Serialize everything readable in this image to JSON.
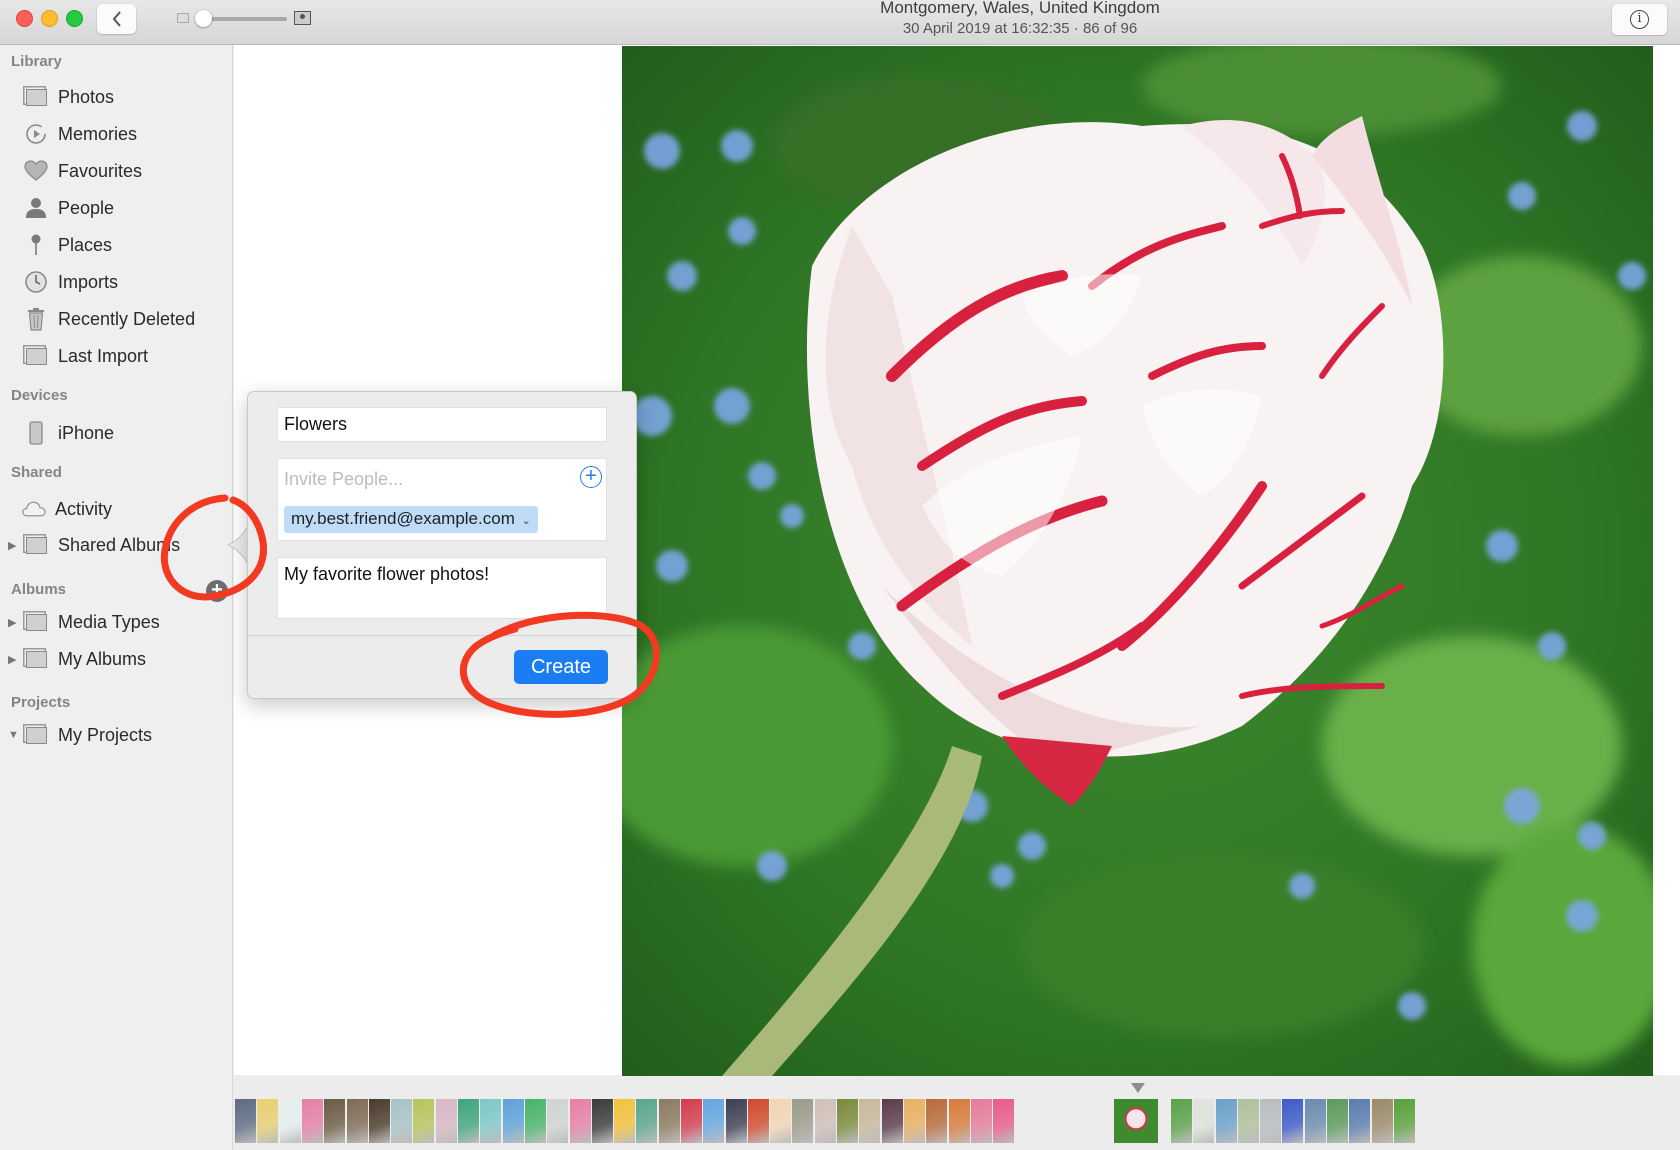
{
  "window": {
    "controls": [
      "close",
      "minimize",
      "maximize"
    ],
    "back_label": "Back"
  },
  "titlebar": {
    "title": "Montgomery, Wales, United Kingdom",
    "subtitle": "30 April 2019 at 16:32:35  ·  86 of 96",
    "zoom_slider_value": 0.0
  },
  "sidebar": {
    "sections": [
      {
        "header": "Library",
        "items": [
          {
            "label": "Photos",
            "icon": "photos-icon"
          },
          {
            "label": "Memories",
            "icon": "memories-icon"
          },
          {
            "label": "Favourites",
            "icon": "heart-icon"
          },
          {
            "label": "People",
            "icon": "person-icon"
          },
          {
            "label": "Places",
            "icon": "pin-icon"
          },
          {
            "label": "Imports",
            "icon": "clock-icon"
          },
          {
            "label": "Recently Deleted",
            "icon": "trash-icon"
          },
          {
            "label": "Last Import",
            "icon": "album-icon"
          }
        ]
      },
      {
        "header": "Devices",
        "items": [
          {
            "label": "iPhone",
            "icon": "iphone-icon"
          }
        ]
      },
      {
        "header": "Shared",
        "items": [
          {
            "label": "Activity",
            "icon": "cloud-icon"
          },
          {
            "label": "Shared Albums",
            "icon": "album-icon",
            "disclosure": "collapsed"
          }
        ]
      },
      {
        "header": "Albums",
        "items": [
          {
            "label": "Media Types",
            "icon": "album-icon",
            "disclosure": "collapsed"
          },
          {
            "label": "My Albums",
            "icon": "album-icon",
            "disclosure": "collapsed"
          }
        ]
      },
      {
        "header": "Projects",
        "items": [
          {
            "label": "My Projects",
            "icon": "album-icon",
            "disclosure": "expanded"
          }
        ]
      }
    ],
    "add_shared_album_label": "+"
  },
  "popover": {
    "album_name": "Flowers",
    "invite_placeholder": "Invite People...",
    "invite_add_label": "+",
    "invitee": "my.best.friend@example.com",
    "comment": "My favorite flower photos!",
    "create_label": "Create"
  },
  "viewer": {
    "photo_description": "Pink and white striped tulip against green foliage with blue forget-me-nots",
    "position": "86 of 96"
  },
  "filmstrip": {
    "selected_index": 86,
    "thumb_colors_left": [
      "#5c6b82",
      "#e8d070",
      "#e6eef0",
      "#e57fa5",
      "#6a5a43",
      "#7d6a55",
      "#4a3a2a",
      "#a7c2c9",
      "#b8c45a",
      "#d8b8c4",
      "#3ea57b",
      "#7cc9c6",
      "#5fa1d8",
      "#46b46a",
      "#cfd5d0",
      "#e57fa5",
      "#3a3a3a",
      "#f3c23b",
      "#58a58e",
      "#8a7a5e",
      "#d23c4f",
      "#65a6e0",
      "#3c3e53",
      "#d14a2c",
      "#f2d6b4",
      "#9a9a8a",
      "#d0c0b8",
      "#7a8a3a",
      "#c8b89a",
      "#5a3a4a",
      "#e8b060",
      "#b86a3a",
      "#d87a3a",
      "#e87a98",
      "#e85a8a"
    ],
    "thumb_colors_right": [
      "#5aa04a",
      "#dfe3da",
      "#6aa0c8",
      "#b0c09a",
      "#b8bcc0",
      "#3a5ac8",
      "#6a8ab0",
      "#5a9a5a",
      "#5a7ab0",
      "#9a8a6a",
      "#5aa03a"
    ]
  },
  "accent_colors": {
    "primary_blue": "#1a7df4",
    "token_blue": "#bedbf7",
    "annotation_red": "#f23a22"
  }
}
